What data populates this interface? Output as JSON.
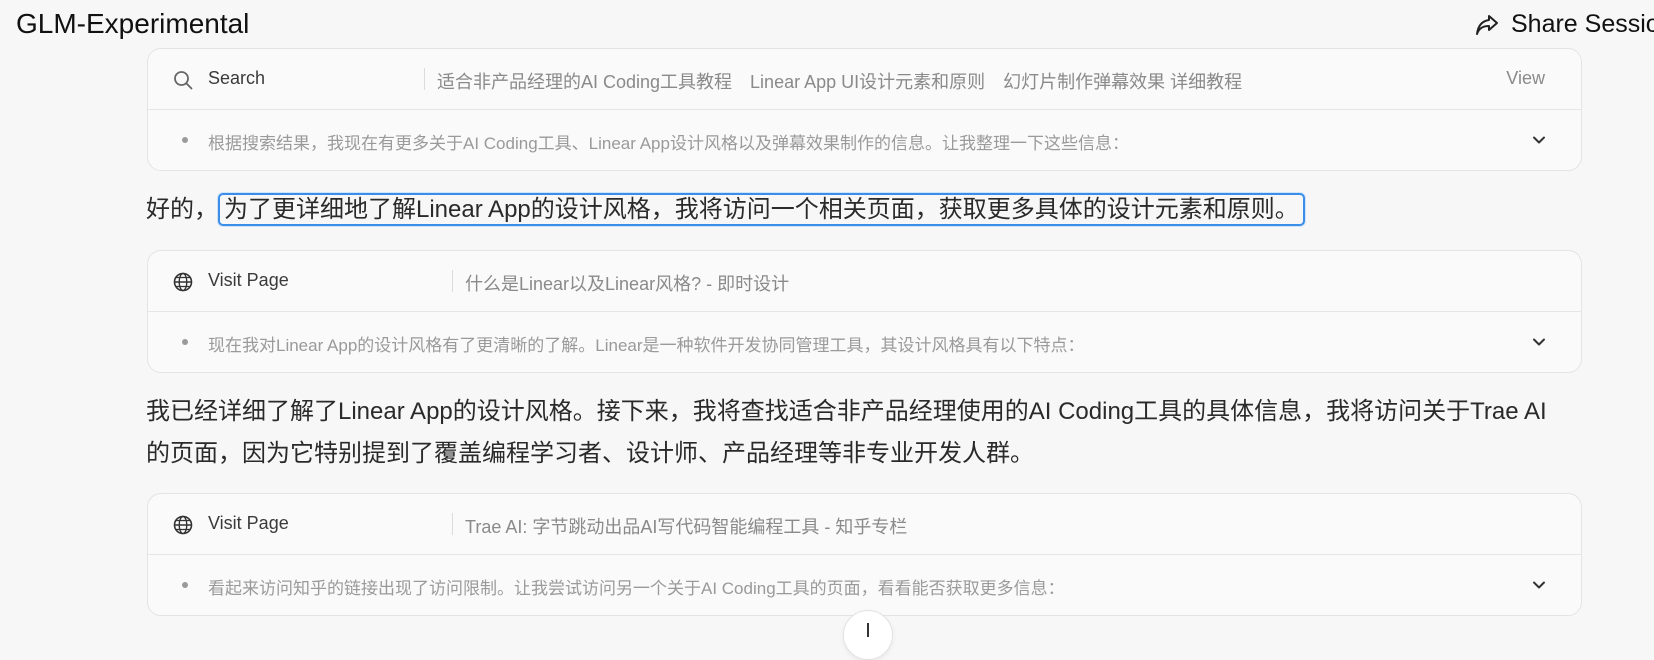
{
  "header": {
    "title": "GLM-Experimental",
    "share_label": "Share Sessio"
  },
  "cards": [
    {
      "kind": "Search",
      "detail": "适合非产品经理的AI Coding工具教程　Linear App UI设计元素和原则　幻灯片制作弹幕效果 详细教程",
      "view_label": "View",
      "summary": "根据搜索结果，我现在有更多关于AI Coding工具、Linear App设计风格以及弹幕效果制作的信息。让我整理一下这些信息："
    },
    {
      "kind": "Visit Page",
      "detail": "什么是Linear以及Linear风格?  - 即时设计",
      "summary": "现在我对Linear App的设计风格有了更清晰的了解。Linear是一种软件开发协同管理工具，其设计风格具有以下特点："
    },
    {
      "kind": "Visit Page",
      "detail": "Trae AI: 字节跳动出品AI写代码智能编程工具 - 知乎专栏",
      "summary": "看起来访问知乎的链接出现了访问限制。让我尝试访问另一个关于AI Coding工具的页面，看看能否获取更多信息："
    }
  ],
  "messages": {
    "m1_prefix": "好的，",
    "m1_highlight": "为了更详细地了解Linear App的设计风格，我将访问一个相关页面，获取更多具体的设计元素和原则。",
    "m2_line1": "我已经详细了解了Linear App的设计风格。接下来，我将查找适合非产品经理使用的AI Coding工具的具体信息，我将访问关于Trae AI",
    "m2_line2": "的页面，因为它特别提到了覆盖编程学习者、设计师、产品经理等非专业开发人群。"
  },
  "icons": {
    "share": "share-icon",
    "search": "search-icon",
    "globe": "globe-icon",
    "chevron": "chevron-down-icon"
  },
  "colors": {
    "highlight_border": "#3b8ee8"
  }
}
